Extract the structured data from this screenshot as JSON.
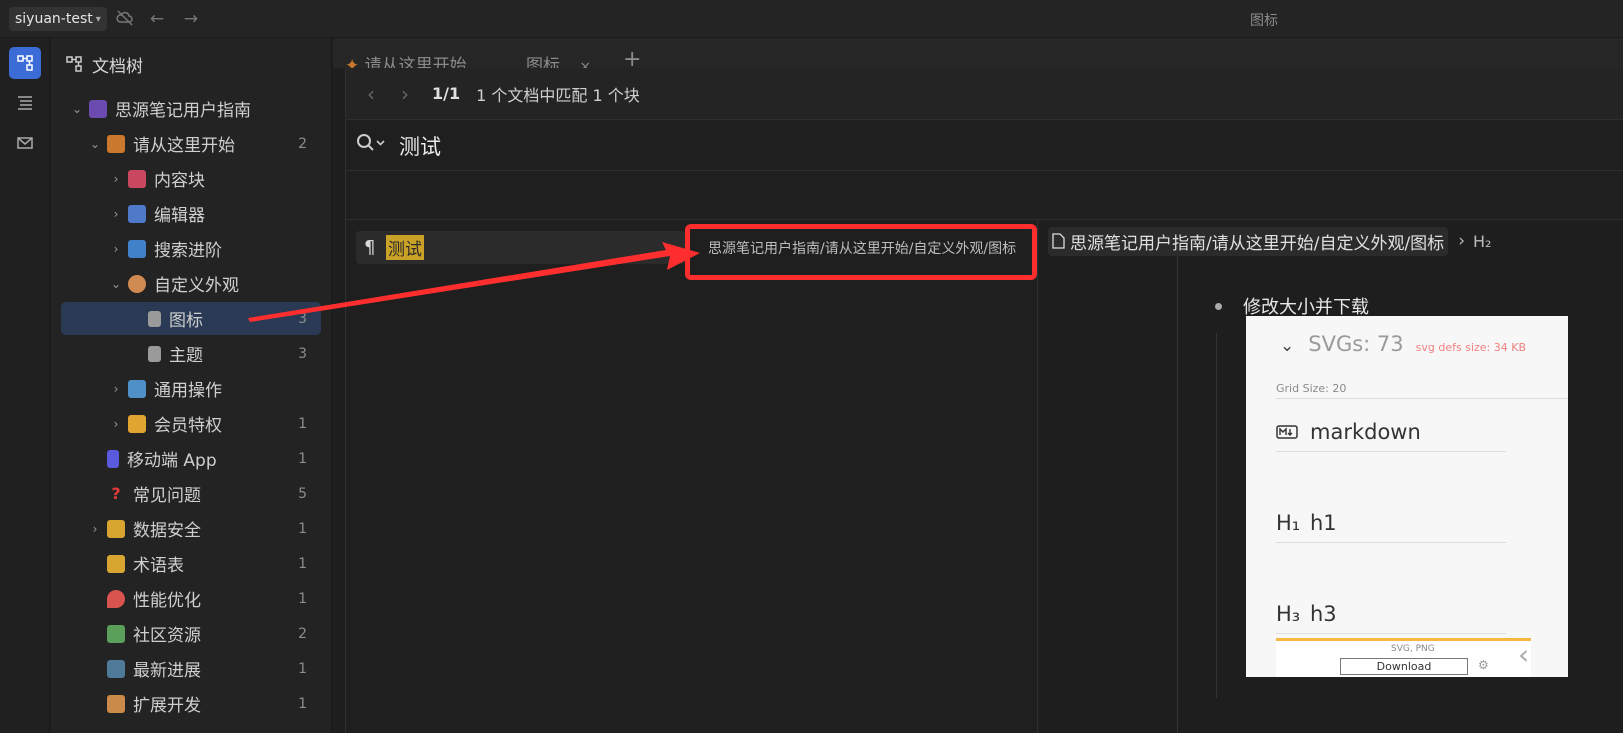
{
  "topbar": {
    "workspace": "siyuan-test",
    "window_title": "图标"
  },
  "tree": {
    "header": "文档树",
    "items": [
      {
        "label": "思源笔记用户指南",
        "count": ""
      },
      {
        "label": "请从这里开始",
        "count": "2"
      },
      {
        "label": "内容块",
        "count": ""
      },
      {
        "label": "编辑器",
        "count": ""
      },
      {
        "label": "搜索进阶",
        "count": ""
      },
      {
        "label": "自定义外观",
        "count": ""
      },
      {
        "label": "图标",
        "count": "3"
      },
      {
        "label": "主题",
        "count": "3"
      },
      {
        "label": "通用操作",
        "count": ""
      },
      {
        "label": "会员特权",
        "count": "1"
      },
      {
        "label": "移动端 App",
        "count": "1"
      },
      {
        "label": "常见问题",
        "count": "5"
      },
      {
        "label": "数据安全",
        "count": "1"
      },
      {
        "label": "术语表",
        "count": "1"
      },
      {
        "label": "性能优化",
        "count": "1"
      },
      {
        "label": "社区资源",
        "count": "2"
      },
      {
        "label": "最新进展",
        "count": "1"
      },
      {
        "label": "扩展开发",
        "count": "1"
      }
    ]
  },
  "tabs": [
    {
      "label": "请从这里开始"
    },
    {
      "label": "图标"
    }
  ],
  "search": {
    "page": "1/1",
    "summary": "1 个文档中匹配 1 个块",
    "query": "测试",
    "result_text": "测试",
    "result_path": "思源笔记用户指南/请从这里开始/自定义外观/图标"
  },
  "preview": {
    "breadcrumb_doc": "思源笔记用户指南/请从这里开始/自定义外观/图标",
    "breadcrumb_heading": "H₂",
    "bullet": "修改大小并下载",
    "svg": {
      "title": "SVGs: 73",
      "defs": "svg defs size: 34 KB",
      "grid": "Grid Size: 20",
      "icons": [
        "markdown",
        "h1",
        "h3"
      ],
      "formats": "SVG, PNG",
      "download": "Download"
    }
  },
  "colors": {
    "accent": "#3a6bd6",
    "highlight": "#c9a227",
    "annotation_red": "#ff2e2e"
  }
}
